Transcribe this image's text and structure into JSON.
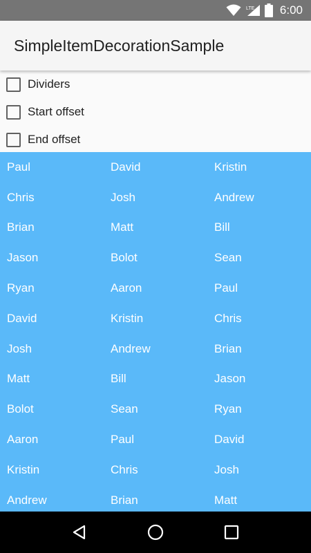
{
  "status_bar": {
    "time": "6:00",
    "network_label": "LTE",
    "icons": [
      "wifi-icon",
      "lte-signal-icon",
      "battery-icon"
    ]
  },
  "app_bar": {
    "title": "SimpleItemDecorationSample"
  },
  "options": [
    {
      "label": "Dividers",
      "checked": false
    },
    {
      "label": "Start offset",
      "checked": false
    },
    {
      "label": "End offset",
      "checked": false
    }
  ],
  "list": {
    "background_color": "#5ab9f9",
    "items": [
      "Paul",
      "David",
      "Kristin",
      "Chris",
      "Josh",
      "Andrew",
      "Brian",
      "Matt",
      "Bill",
      "Jason",
      "Bolot",
      "Sean",
      "Ryan",
      "Aaron",
      "Paul",
      "David",
      "Kristin",
      "Chris",
      "Josh",
      "Andrew",
      "Brian",
      "Matt",
      "Bill",
      "Jason",
      "Bolot",
      "Sean",
      "Ryan",
      "Aaron",
      "Paul",
      "David",
      "Kristin",
      "Chris",
      "Josh",
      "Andrew",
      "Brian",
      "Matt"
    ]
  },
  "nav_bar": {
    "icons": [
      "back-icon",
      "home-icon",
      "recents-icon"
    ]
  }
}
